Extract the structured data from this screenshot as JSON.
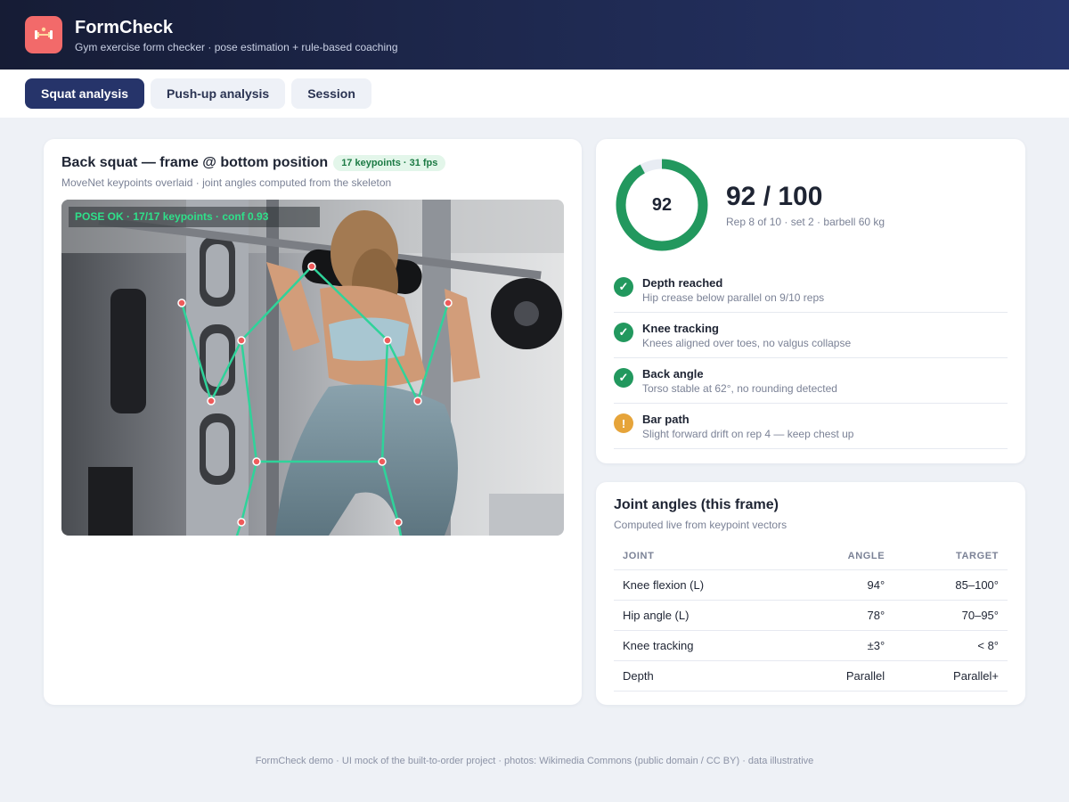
{
  "app": {
    "title": "FormCheck",
    "subtitle": "Gym exercise form checker · pose estimation + rule-based coaching",
    "logo_icon": "dumbbell-icon"
  },
  "tabs": [
    {
      "label": "Squat analysis",
      "active": true
    },
    {
      "label": "Push-up analysis",
      "active": false
    },
    {
      "label": "Session",
      "active": false
    }
  ],
  "frame": {
    "title": "Back squat — frame @ bottom position",
    "badge": "17 keypoints · 31 fps",
    "subtitle": "MoveNet keypoints overlaid · joint angles computed from the skeleton",
    "pose_status": "POSE OK · 17/17 keypoints · conf 0.93"
  },
  "score": {
    "value": 92,
    "max": 100,
    "ring_label": "92",
    "big_label": "92 / 100",
    "meta": "Rep 8 of 10 · set 2 · barbell 60 kg"
  },
  "checks": [
    {
      "title": "Depth reached",
      "desc": "Hip crease below parallel on 9/10 reps",
      "status": "ok",
      "icon": "✓"
    },
    {
      "title": "Knee tracking",
      "desc": "Knees aligned over toes, no valgus collapse",
      "status": "ok",
      "icon": "✓"
    },
    {
      "title": "Back angle",
      "desc": "Torso stable at 62°, no rounding detected",
      "status": "ok",
      "icon": "✓"
    },
    {
      "title": "Bar path",
      "desc": "Slight forward drift on rep 4 — keep chest up",
      "status": "warn",
      "icon": "!"
    }
  ],
  "angles": {
    "title": "Joint angles (this frame)",
    "subtitle": "Computed live from keypoint vectors",
    "headers": [
      "JOINT",
      "ANGLE",
      "TARGET"
    ],
    "rows": [
      [
        "Knee flexion (L)",
        "94°",
        "85–100°"
      ],
      [
        "Hip angle (L)",
        "78°",
        "70–95°"
      ],
      [
        "Knee tracking",
        "±3°",
        "< 8°"
      ],
      [
        "Depth",
        "Parallel",
        "Parallel+"
      ]
    ]
  },
  "footer": "FormCheck demo · UI mock of the built-to-order project · photos: Wikimedia Commons (public domain / CC BY) · data illustrative",
  "colors": {
    "accent": "#26346a",
    "ok": "#22985e",
    "warn": "#e6a43a",
    "skeleton": "#2fd39a",
    "keypoint": "#ef5a5a"
  }
}
